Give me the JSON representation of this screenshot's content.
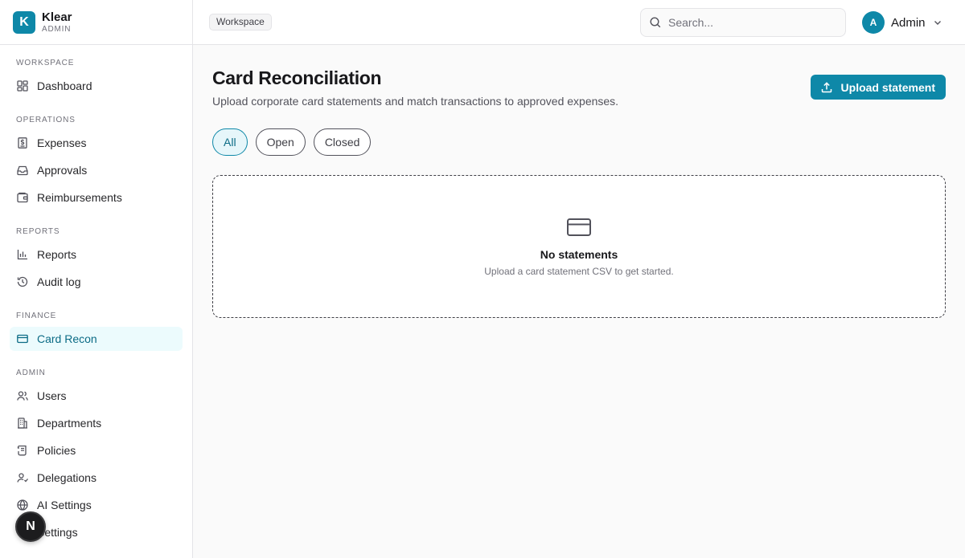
{
  "brand": {
    "logo_letter": "K",
    "name": "Klear",
    "subtitle": "ADMIN"
  },
  "sidebar": {
    "sections": [
      {
        "label": "WORKSPACE",
        "items": [
          {
            "label": "Dashboard",
            "icon": "dashboard-icon"
          }
        ]
      },
      {
        "label": "OPERATIONS",
        "items": [
          {
            "label": "Expenses",
            "icon": "receipt-icon"
          },
          {
            "label": "Approvals",
            "icon": "inbox-icon"
          },
          {
            "label": "Reimbursements",
            "icon": "wallet-icon"
          }
        ]
      },
      {
        "label": "REPORTS",
        "items": [
          {
            "label": "Reports",
            "icon": "bar-chart-icon"
          },
          {
            "label": "Audit log",
            "icon": "history-icon"
          }
        ]
      },
      {
        "label": "FINANCE",
        "items": [
          {
            "label": "Card Recon",
            "icon": "credit-card-icon",
            "active": true
          }
        ]
      },
      {
        "label": "ADMIN",
        "items": [
          {
            "label": "Users",
            "icon": "users-icon"
          },
          {
            "label": "Departments",
            "icon": "building-icon"
          },
          {
            "label": "Policies",
            "icon": "scroll-icon"
          },
          {
            "label": "Delegations",
            "icon": "user-check-icon"
          },
          {
            "label": "AI Settings",
            "icon": "globe-icon"
          },
          {
            "label": "Settings",
            "icon": "gear-icon"
          }
        ]
      }
    ]
  },
  "floating_avatar": {
    "letter": "N"
  },
  "topbar": {
    "breadcrumb": "Workspace",
    "search_placeholder": "Search...",
    "user": {
      "initial": "A",
      "name": "Admin"
    }
  },
  "main": {
    "title": "Card Reconciliation",
    "subtitle": "Upload corporate card statements and match transactions to approved expenses.",
    "upload_label": "Upload statement",
    "filters": [
      {
        "label": "All",
        "active": true
      },
      {
        "label": "Open"
      },
      {
        "label": "Closed"
      }
    ],
    "empty": {
      "title": "No statements",
      "subtitle": "Upload a card statement CSV to get started."
    }
  },
  "colors": {
    "accent": "#0e88a8",
    "active_bg": "#ecfbfd",
    "active_text": "#0b6b85"
  }
}
